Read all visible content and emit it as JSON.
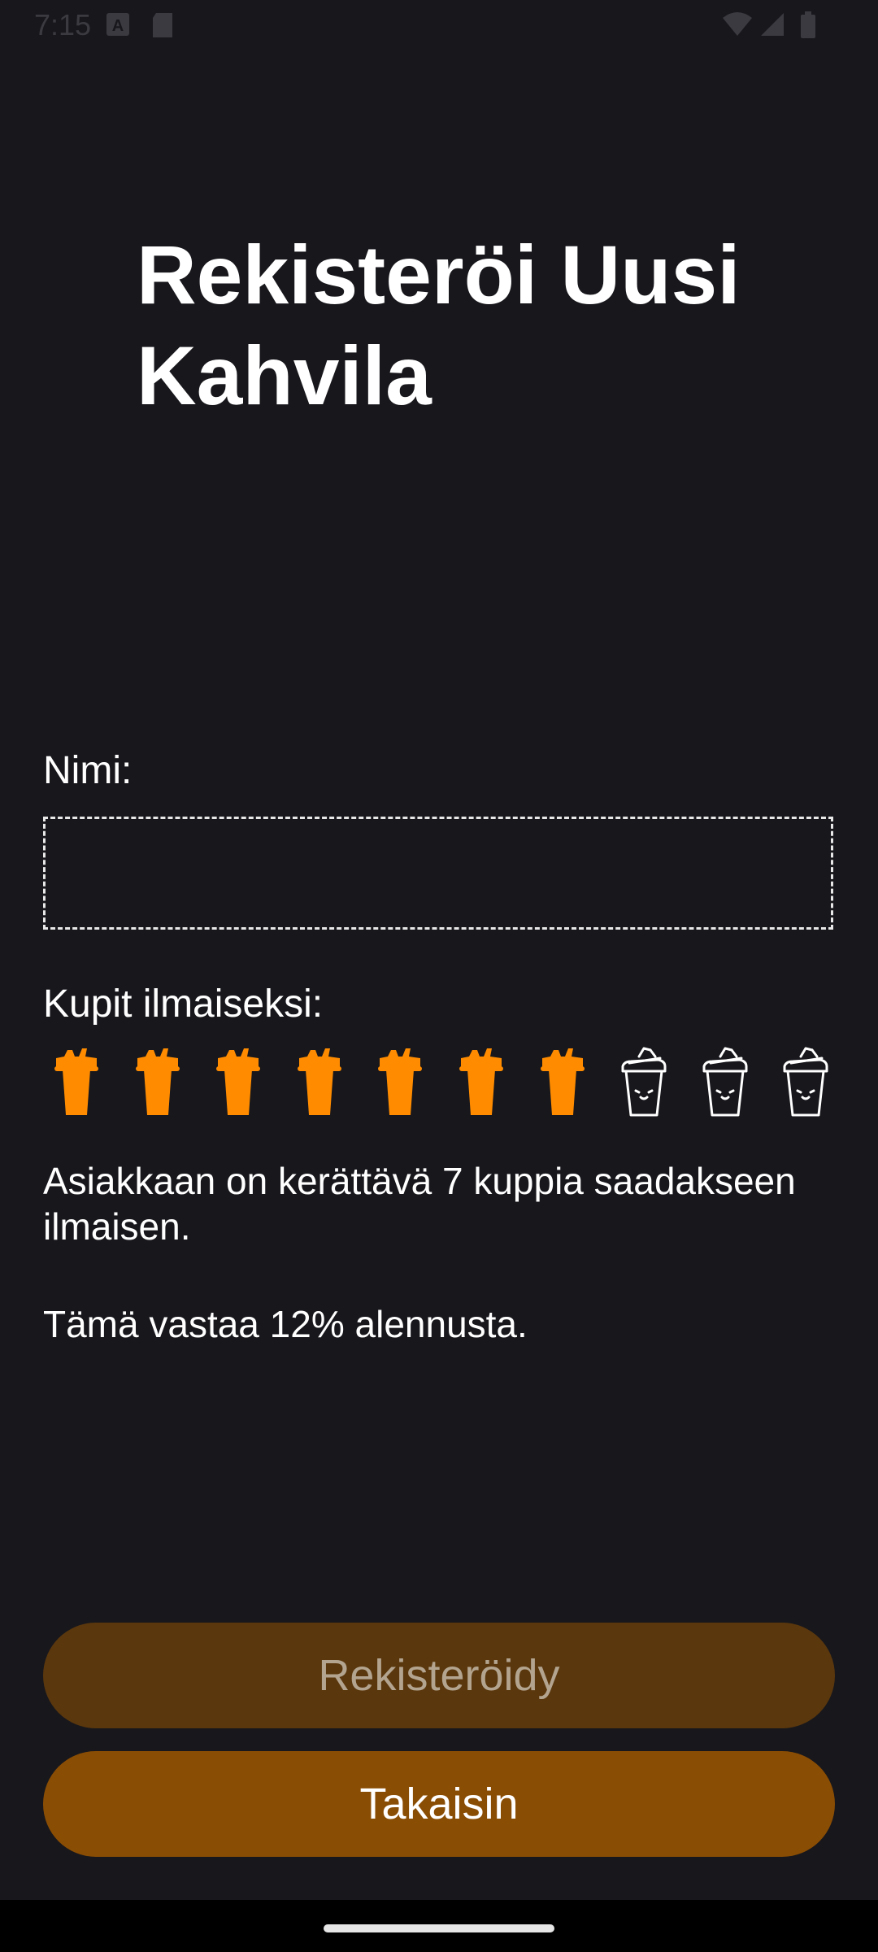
{
  "status_bar": {
    "time": "7:15",
    "icons": [
      "accessibility-icon",
      "sd-card-icon",
      "wifi-icon",
      "signal-icon",
      "battery-icon"
    ]
  },
  "title": "Rekisteröi Uusi Kahvila",
  "form": {
    "name_label": "Nimi:",
    "name_value": "",
    "cups_label": "Kupit ilmaiseksi:",
    "cups_filled": 7,
    "cups_total": 10,
    "filled_color": "#ff8c00",
    "empty_color": "#ffffff"
  },
  "info": {
    "line1": "Asiakkaan on kerättävä 7 kuppia saadakseen ilmaisen.",
    "line2": "Tämä vastaa 12% alennusta."
  },
  "buttons": {
    "register": "Rekisteröidy",
    "back": "Takaisin"
  }
}
